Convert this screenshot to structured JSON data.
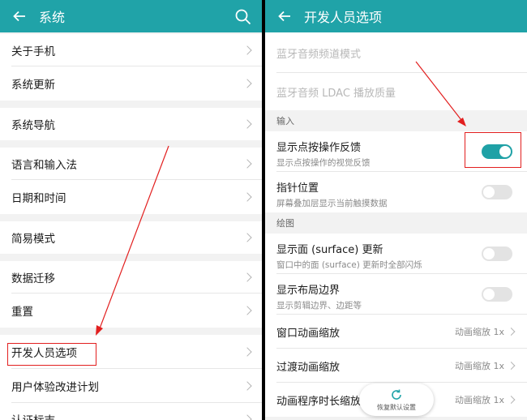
{
  "left": {
    "appbar": {
      "title": "系统"
    },
    "items": [
      {
        "label": "关于手机"
      },
      {
        "label": "系统更新"
      },
      {
        "label": "系统导航"
      },
      {
        "label": "语言和输入法"
      },
      {
        "label": "日期和时间"
      },
      {
        "label": "简易模式"
      },
      {
        "label": "数据迁移"
      },
      {
        "label": "重置"
      },
      {
        "label": "开发人员选项"
      },
      {
        "label": "用户体验改进计划"
      },
      {
        "label": "认证标志"
      }
    ]
  },
  "right": {
    "appbar": {
      "title": "开发人员选项"
    },
    "items": [
      {
        "title": "蓝牙音频频道模式"
      },
      {
        "title": "蓝牙音频 LDAC 播放质量"
      }
    ],
    "sections": {
      "input": "输入",
      "drawing": "绘图"
    },
    "toggles": [
      {
        "title": "显示点按操作反馈",
        "subtitle": "显示点按操作的视觉反馈",
        "on": true
      },
      {
        "title": "指针位置",
        "subtitle": "屏幕叠加层显示当前触摸数据",
        "on": false
      },
      {
        "title": "显示面 (surface) 更新",
        "subtitle": "窗口中的面 (surface) 更新时全部闪烁",
        "on": false
      },
      {
        "title": "显示布局边界",
        "subtitle": "显示剪辑边界、边距等",
        "on": false
      }
    ],
    "values": [
      {
        "title": "窗口动画缩放",
        "value": "动画缩放 1x"
      },
      {
        "title": "过渡动画缩放",
        "value": "动画缩放 1x"
      },
      {
        "title": "动画程序时长缩放",
        "value": "动画缩放 1x"
      }
    ],
    "fab": {
      "label": "恢复默认设置"
    }
  },
  "colors": {
    "appbar": "#20a3a8",
    "accent": "#1fa1a6",
    "annotation": "#e21f1f"
  }
}
